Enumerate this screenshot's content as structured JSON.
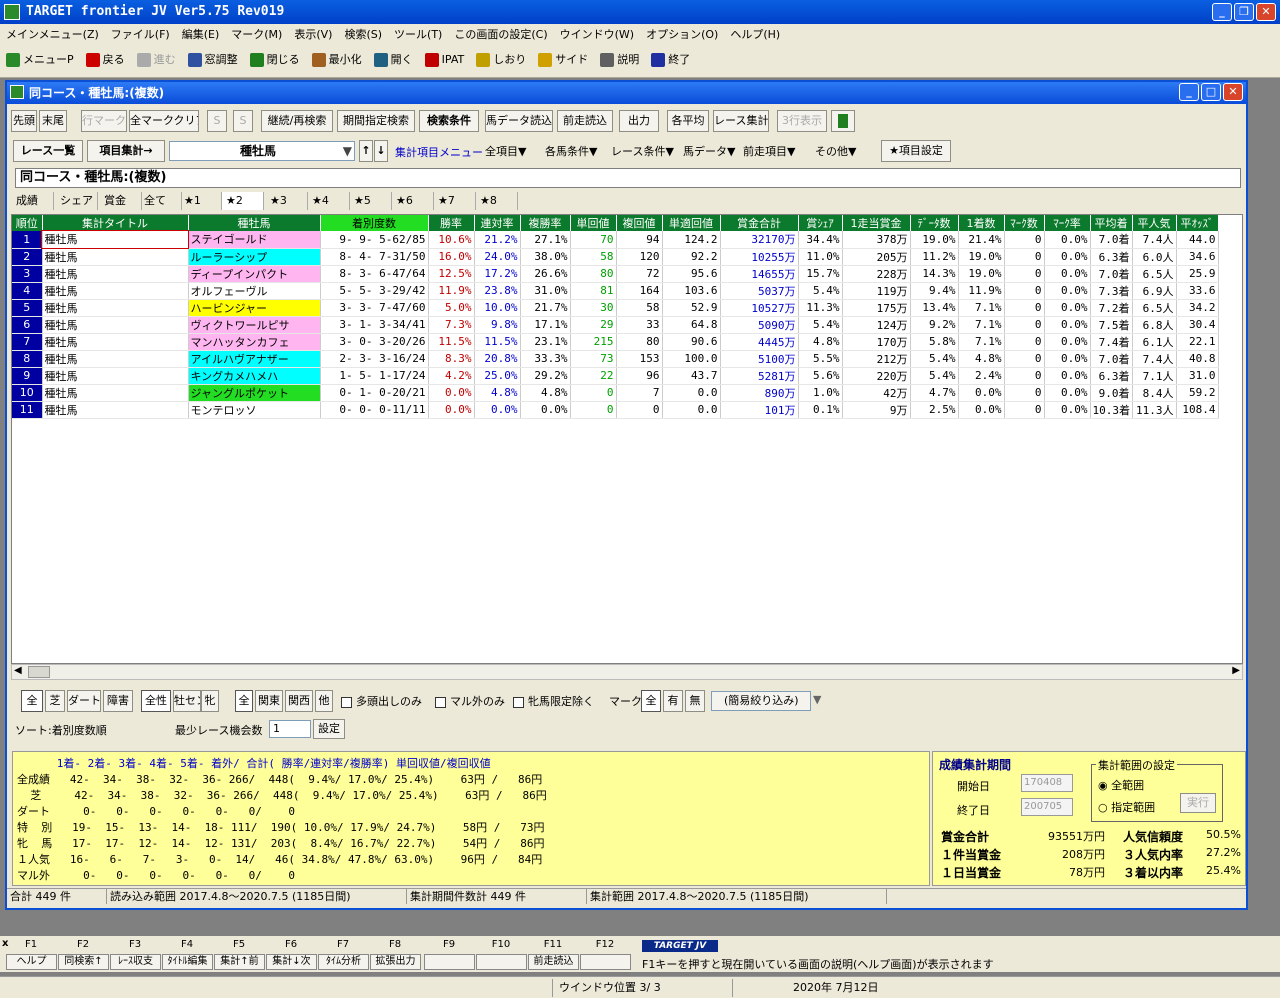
{
  "app_title": "TARGET frontier JV  Ver5.75  Rev019",
  "menu": [
    "メインメニュー(Z)",
    "ファイル(F)",
    "編集(E)",
    "マーク(M)",
    "表示(V)",
    "検索(S)",
    "ツール(T)",
    "この画面の設定(C)",
    "ウインドウ(W)",
    "オプション(O)",
    "ヘルプ(H)"
  ],
  "toolbar": [
    {
      "label": "メニューP",
      "icon": "menu-icon",
      "color": "#2a8a2a"
    },
    {
      "label": "戻る",
      "icon": "back-arrow-icon",
      "color": "#cc0000"
    },
    {
      "label": "進む",
      "icon": "forward-arrow-icon",
      "color": "#aaaaaa"
    },
    {
      "label": "窓調整",
      "icon": "window-adjust-icon",
      "color": "#3050a0"
    },
    {
      "label": "閉じる",
      "icon": "close-door-icon",
      "color": "#208020"
    },
    {
      "label": "最小化",
      "icon": "minimize-icon",
      "color": "#a06020"
    },
    {
      "label": "開く",
      "icon": "open-icon",
      "color": "#206080"
    },
    {
      "label": "IPAT",
      "icon": "pat-icon",
      "color": "#c00000"
    },
    {
      "label": "しおり",
      "icon": "bookmark-icon",
      "color": "#c0a000"
    },
    {
      "label": "サイド",
      "icon": "side-icon",
      "color": "#d0a000"
    },
    {
      "label": "説明",
      "icon": "help-icon",
      "color": "#606060"
    },
    {
      "label": "終了",
      "icon": "exit-icon",
      "color": "#2030a0"
    }
  ],
  "child_title": "同コース・種牡馬:(複数)",
  "buttons_row1": [
    "先頭",
    "末尾",
    "行マーク",
    "全マーククリア",
    "S",
    "S",
    "継続/再検索",
    "期間指定検索",
    "検索条件",
    "馬データ読込",
    "前走読込",
    "出力",
    "各平均",
    "レース集計",
    "3行表示"
  ],
  "row2": {
    "race_list": "レース一覧",
    "item_total": "項目集計→",
    "dropdown_value": "種牡馬",
    "sort_up": "↑",
    "sort_down": "↓",
    "menu_link": "集計項目メニュー",
    "menus": [
      "全項目▼",
      "各馬条件▼",
      "レース条件▼",
      "馬データ▼",
      "前走項目▼",
      "その他▼"
    ],
    "item_settings": "★項目設定"
  },
  "subtitle": "同コース・種牡馬:(複数)",
  "tabs": [
    "成績",
    "シェア",
    "賞金",
    "全て",
    "★1",
    "★2",
    "★3",
    "★4",
    "★5",
    "★6",
    "★7",
    "★8"
  ],
  "table": {
    "headers": [
      "順位",
      "集計タイトル",
      "種牡馬",
      "着別度数",
      "勝率",
      "連対率",
      "複勝率",
      "単回値",
      "複回値",
      "単適回値",
      "賞金合計",
      "賞ｼｪｱ",
      "1走当賞金",
      "ﾃﾞｰﾀ数",
      "1着数",
      "ﾏｰｸ数",
      "ﾏｰｸ率",
      "平均着",
      "平人気",
      "平ｵｯｽﾞ"
    ],
    "rows": [
      [
        "1",
        "種牡馬",
        "ステイゴールド",
        "9- 9- 5-62/85",
        "10.6%",
        "21.2%",
        "27.1%",
        "70",
        "94",
        "124.2",
        "32170万",
        "34.4%",
        "378万",
        "19.0%",
        "21.4%",
        "0",
        "0.0%",
        "7.0着",
        "7.4人",
        "44.0"
      ],
      [
        "2",
        "種牡馬",
        "ルーラーシップ",
        "8- 4- 7-31/50",
        "16.0%",
        "24.0%",
        "38.0%",
        "58",
        "120",
        "92.2",
        "10255万",
        "11.0%",
        "205万",
        "11.2%",
        "19.0%",
        "0",
        "0.0%",
        "6.3着",
        "6.0人",
        "34.6"
      ],
      [
        "3",
        "種牡馬",
        "ディープインパクト",
        "8- 3- 6-47/64",
        "12.5%",
        "17.2%",
        "26.6%",
        "80",
        "72",
        "95.6",
        "14655万",
        "15.7%",
        "228万",
        "14.3%",
        "19.0%",
        "0",
        "0.0%",
        "7.0着",
        "6.5人",
        "25.9"
      ],
      [
        "4",
        "種牡馬",
        "オルフェーヴル",
        "5- 5- 3-29/42",
        "11.9%",
        "23.8%",
        "31.0%",
        "81",
        "164",
        "103.6",
        "5037万",
        "5.4%",
        "119万",
        "9.4%",
        "11.9%",
        "0",
        "0.0%",
        "7.3着",
        "6.9人",
        "33.6"
      ],
      [
        "5",
        "種牡馬",
        "ハービンジャー",
        "3- 3- 7-47/60",
        "5.0%",
        "10.0%",
        "21.7%",
        "30",
        "58",
        "52.9",
        "10527万",
        "11.3%",
        "175万",
        "13.4%",
        "7.1%",
        "0",
        "0.0%",
        "7.2着",
        "6.5人",
        "34.2"
      ],
      [
        "6",
        "種牡馬",
        "ヴィクトワールピサ",
        "3- 1- 3-34/41",
        "7.3%",
        "9.8%",
        "17.1%",
        "29",
        "33",
        "64.8",
        "5090万",
        "5.4%",
        "124万",
        "9.2%",
        "7.1%",
        "0",
        "0.0%",
        "7.5着",
        "6.8人",
        "30.4"
      ],
      [
        "7",
        "種牡馬",
        "マンハッタンカフェ",
        "3- 0- 3-20/26",
        "11.5%",
        "11.5%",
        "23.1%",
        "215",
        "80",
        "90.6",
        "4445万",
        "4.8%",
        "170万",
        "5.8%",
        "7.1%",
        "0",
        "0.0%",
        "7.4着",
        "6.1人",
        "22.1"
      ],
      [
        "8",
        "種牡馬",
        "アイルハヴアナザー",
        "2- 3- 3-16/24",
        "8.3%",
        "20.8%",
        "33.3%",
        "73",
        "153",
        "100.0",
        "5100万",
        "5.5%",
        "212万",
        "5.4%",
        "4.8%",
        "0",
        "0.0%",
        "7.0着",
        "7.4人",
        "40.8"
      ],
      [
        "9",
        "種牡馬",
        "キングカメハメハ",
        "1- 5- 1-17/24",
        "4.2%",
        "25.0%",
        "29.2%",
        "22",
        "96",
        "43.7",
        "5281万",
        "5.6%",
        "220万",
        "5.4%",
        "2.4%",
        "0",
        "0.0%",
        "6.3着",
        "7.1人",
        "31.0"
      ],
      [
        "10",
        "種牡馬",
        "ジャングルポケット",
        "0- 1- 0-20/21",
        "0.0%",
        "4.8%",
        "4.8%",
        "0",
        "7",
        "0.0",
        "890万",
        "1.0%",
        "42万",
        "4.7%",
        "0.0%",
        "0",
        "0.0%",
        "9.0着",
        "8.4人",
        "59.2"
      ],
      [
        "11",
        "種牡馬",
        "モンテロッソ",
        "0- 0- 0-11/11",
        "0.0%",
        "0.0%",
        "0.0%",
        "0",
        "0",
        "0.0",
        "101万",
        "0.1%",
        "9万",
        "2.5%",
        "0.0%",
        "0",
        "0.0%",
        "10.3着",
        "11.3人",
        "108.4"
      ]
    ],
    "sire_colors": [
      "#ffb6f0",
      "#00ffff",
      "#ffb6f0",
      "#ffffff",
      "#ffff00",
      "#ffb6f0",
      "#ffb6f0",
      "#00ffff",
      "#00ffff",
      "#22dd22",
      "#ffffff"
    ]
  },
  "filters": {
    "group1": [
      "全",
      "芝",
      "ダート",
      "障害"
    ],
    "group2": [
      "全性",
      "牡セン",
      "牝"
    ],
    "group3": [
      "全",
      "関東",
      "関西",
      "他"
    ],
    "checks": [
      "多頭出しのみ",
      "マル外のみ",
      "牝馬限定除く"
    ],
    "mark_label": "マーク",
    "mark_btns": [
      "全",
      "有",
      "無"
    ],
    "narrow": "(簡易絞り込み)"
  },
  "sort_text": "ソート:着別度数順",
  "min_race": {
    "label": "最少レース機会数",
    "value": "1",
    "button": "設定"
  },
  "stats": {
    "header": "      1着- 2着- 3着- 4着- 5着- 着外/ 合計( 勝率/連対率/複勝率) 単回収値/複回収値",
    "lines": [
      "全成績   42-  34-  38-  32-  36- 266/  448(  9.4%/ 17.0%/ 25.4%)    63円 /   86円",
      "  芝     42-  34-  38-  32-  36- 266/  448(  9.4%/ 17.0%/ 25.4%)    63円 /   86円",
      "ダート     0-   0-   0-   0-   0-   0/    0",
      "特  別   19-  15-  13-  14-  18- 111/  190( 10.0%/ 17.9%/ 24.7%)    58円 /   73円",
      "牝  馬   17-  17-  12-  14-  12- 131/  203(  8.4%/ 16.7%/ 22.7%)    54円 /   86円",
      "１人気   16-   6-   7-   3-   0-  14/   46( 34.8%/ 47.8%/ 63.0%)    96円 /   84円",
      "マル外     0-   0-   0-   0-   0-   0/    0"
    ]
  },
  "period": {
    "title": "成績集計期間",
    "start_label": "開始日",
    "start_value": "170408",
    "end_label": "終了日",
    "end_value": "200705",
    "range_title": "集計範囲の設定",
    "radio_all": "全範囲",
    "radio_range": "指定範囲",
    "exec": "実行",
    "prize_total_label": "賞金合計",
    "prize_total": "93551万円",
    "per_race_label": "１件当賞金",
    "per_race": "208万円",
    "per_day_label": "１日当賞金",
    "per_day": "78万円",
    "pop_rel_label": "人気信頼度",
    "pop_rel": "50.5%",
    "pop3_label": "３人気内率",
    "pop3": "27.2%",
    "top3_label": "３着以内率",
    "top3": "25.4%"
  },
  "status": [
    "合計 449 件",
    "読み込み範囲 2017.4.8～2020.7.5 (1185日間)",
    "集計期間件数計 449 件",
    "集計範囲 2017.4.8～2020.7.5 (1185日間)"
  ],
  "fkeys": {
    "keys": [
      "F1",
      "F2",
      "F3",
      "F4",
      "F5",
      "F6",
      "F7",
      "F8",
      "F9",
      "F10",
      "F11",
      "F12"
    ],
    "labels": [
      "ヘルプ",
      "同検索↑",
      "ﾚｰｽ収支",
      "ﾀｲﾄﾙ編集",
      "集計↑前",
      "集計↓次",
      "ﾀｲﾑ分析",
      "拡張出力",
      "",
      "",
      "前走読込",
      ""
    ],
    "logo": "TARGET JV",
    "hint": "F1キーを押すと現在開いている画面の説明(ヘルプ画面)が表示されます"
  },
  "bottom": {
    "window_pos": "ウインドウ位置 3/ 3",
    "date": "2020年 7月12日"
  }
}
